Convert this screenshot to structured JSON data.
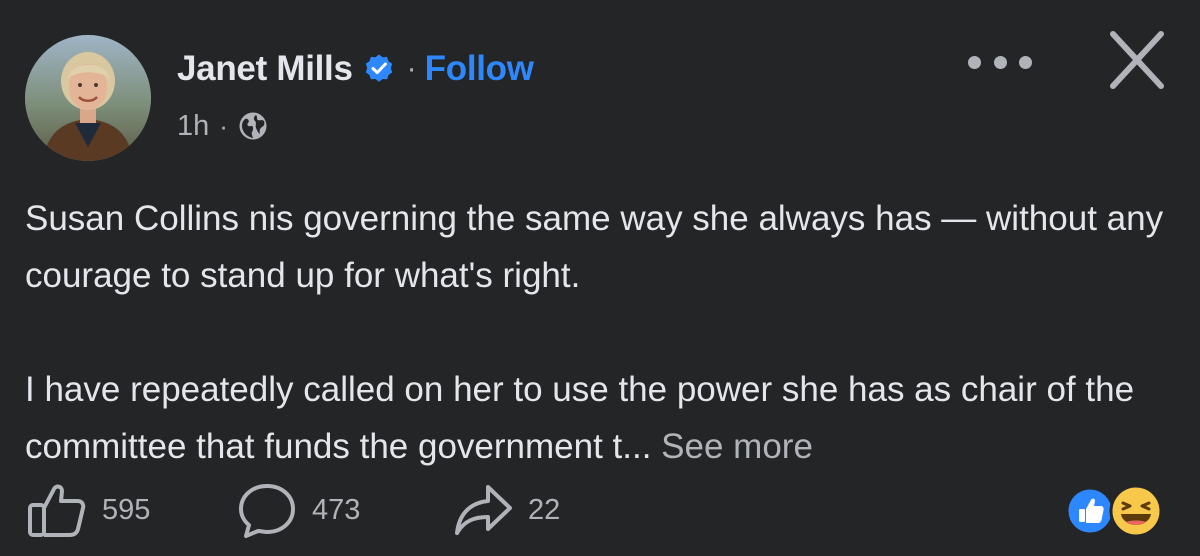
{
  "post": {
    "author": "Janet Mills",
    "follow_label": "Follow",
    "separator": "·",
    "time": "1h",
    "text_paragraphs": [
      "Susan Collins nis governing the same way she always has — without any courage to stand up for what's right.",
      "I have repeatedly called on her to use the power she has as chair of the committee that funds the government t..."
    ],
    "see_more_label": "See more"
  },
  "actions": {
    "likes": "595",
    "comments": "473",
    "shares": "22"
  },
  "icons": {
    "verified": "verified-badge-icon",
    "audience": "globe-icon",
    "more": "more-options-icon",
    "close": "close-icon",
    "like": "thumbs-up-icon",
    "comment": "comment-bubble-icon",
    "share": "share-arrow-icon",
    "reactions": [
      "like-reaction-icon",
      "haha-reaction-icon"
    ]
  },
  "colors": {
    "background": "#242526",
    "primary_text": "#e4e6eb",
    "secondary_text": "#b0b3b8",
    "accent_blue": "#2d88ff",
    "haha_yellow": "#f7c84a"
  }
}
